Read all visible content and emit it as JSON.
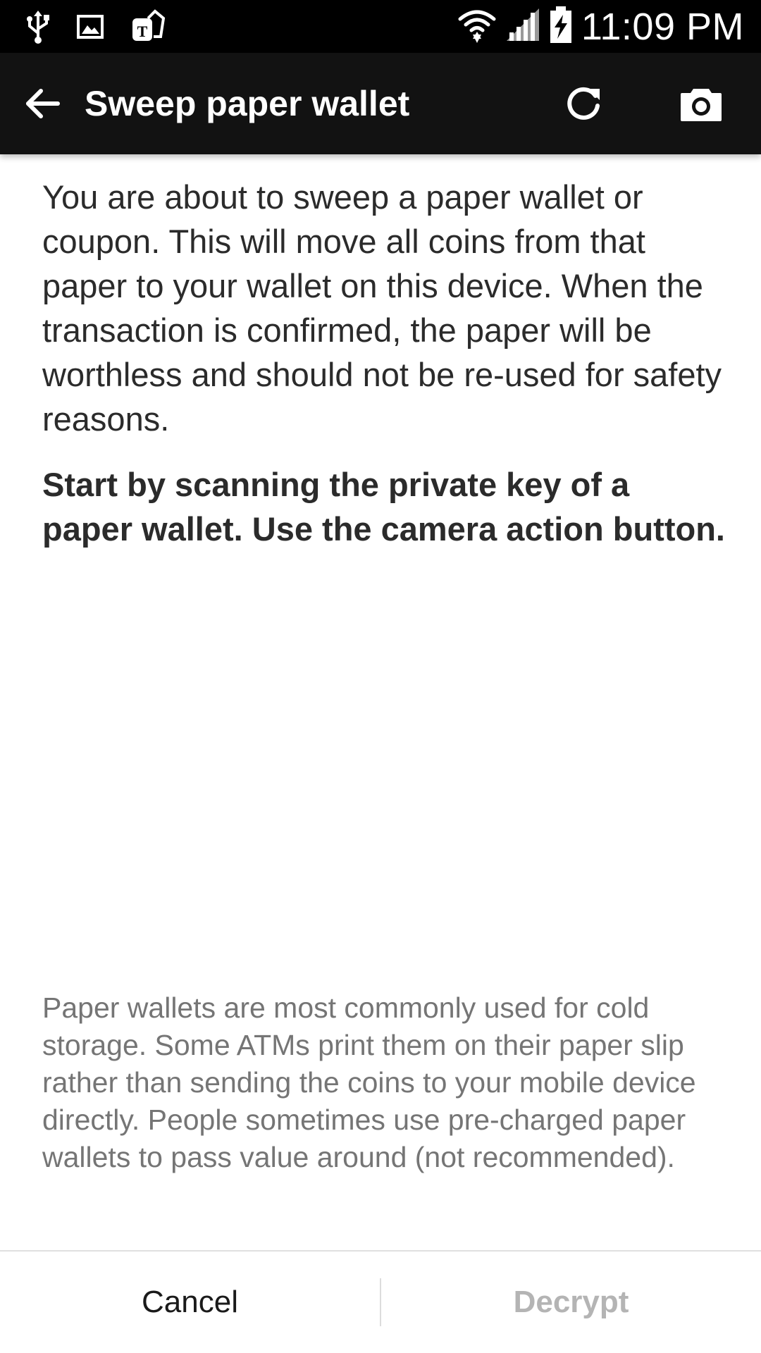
{
  "status_bar": {
    "time": "11:09 PM",
    "icons": [
      "usb-icon",
      "image-icon",
      "tmobile-icon",
      "wifi-icon",
      "signal-icon",
      "battery-charging-icon"
    ]
  },
  "app_bar": {
    "title": "Sweep paper wallet",
    "back_icon": "arrow-back-icon",
    "refresh_icon": "refresh-icon",
    "camera_icon": "camera-icon"
  },
  "main": {
    "intro": "You are about to sweep a paper wallet or coupon. This will move all coins from that paper to your wallet on this device. When the transaction is confirmed, the paper will be worthless and should not be re-used for safety reasons.",
    "instruction": "Start by scanning the private key of a paper wallet. Use the camera action button.",
    "note": "Paper wallets are most commonly used for cold storage. Some ATMs print them on their paper slip rather than sending the coins to your mobile device directly. People sometimes use pre-charged paper wallets to pass value around (not recommended)."
  },
  "buttons": {
    "cancel": "Cancel",
    "decrypt": "Decrypt"
  }
}
